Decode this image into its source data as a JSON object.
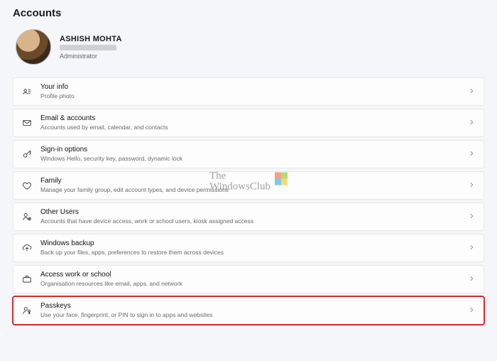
{
  "page_title": "Accounts",
  "profile": {
    "name": "ASHISH MOHTA",
    "role": "Administrator"
  },
  "watermark": {
    "line1": "The",
    "line2": "WindowsClub"
  },
  "items": [
    {
      "icon": "person-card-icon",
      "title": "Your info",
      "subtitle": "Profile photo"
    },
    {
      "icon": "mail-icon",
      "title": "Email & accounts",
      "subtitle": "Accounts used by email, calendar, and contacts"
    },
    {
      "icon": "key-icon",
      "title": "Sign-in options",
      "subtitle": "Windows Hello, security key, password, dynamic lock"
    },
    {
      "icon": "family-icon",
      "title": "Family",
      "subtitle": "Manage your family group, edit account types, and device permissions"
    },
    {
      "icon": "other-users-icon",
      "title": "Other Users",
      "subtitle": "Accounts that have device access, work or school users, kiosk assigned access"
    },
    {
      "icon": "backup-icon",
      "title": "Windows backup",
      "subtitle": "Back up your files, apps, preferences to restore them across devices"
    },
    {
      "icon": "briefcase-icon",
      "title": "Access work or school",
      "subtitle": "Organisation resources like email, apps, and network"
    },
    {
      "icon": "passkeys-icon",
      "title": "Passkeys",
      "subtitle": "Use your face, fingerprint, or PIN to sign in to apps and websites",
      "highlight": true
    }
  ]
}
